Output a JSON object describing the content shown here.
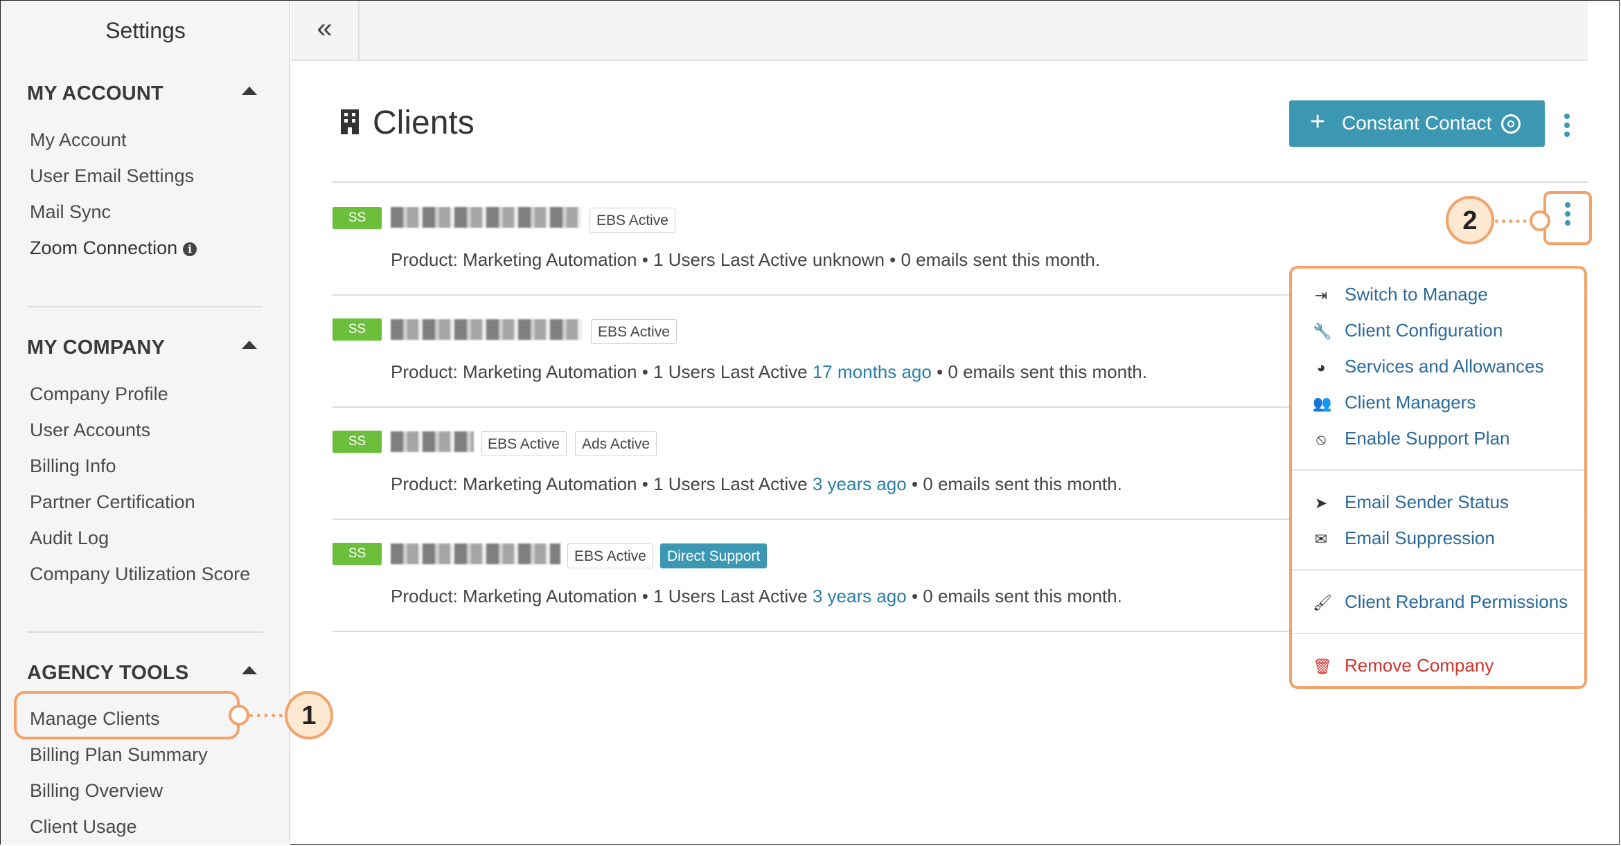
{
  "sidebar": {
    "title": "Settings",
    "sections": [
      {
        "label": "MY ACCOUNT",
        "items": [
          "My Account",
          "User Email Settings",
          "Mail Sync",
          "Zoom Connection"
        ]
      },
      {
        "label": "MY COMPANY",
        "items": [
          "Company Profile",
          "User Accounts",
          "Billing Info",
          "Partner Certification",
          "Audit Log",
          "Company Utilization Score"
        ]
      },
      {
        "label": "AGENCY TOOLS",
        "items": [
          "Manage Clients",
          "Billing Plan Summary",
          "Billing Overview",
          "Client Usage"
        ]
      }
    ]
  },
  "topbar": {
    "collapse_icon": "«"
  },
  "header": {
    "title": "Clients",
    "icon": "building-icon",
    "button_label": "Constant Contact",
    "button_plus": "+"
  },
  "clients": [
    {
      "badge": "SS",
      "tags": [
        "EBS Active"
      ],
      "meta_prefix": "Product: Marketing Automation • 1 Users Last Active ",
      "last_active": "unknown",
      "meta_suffix": " • 0 emails sent this month."
    },
    {
      "badge": "SS",
      "tags": [
        "EBS Active"
      ],
      "meta_prefix": "Product: Marketing Automation • 1 Users Last Active ",
      "last_active": "17 months ago",
      "meta_suffix": " • 0 emails sent this month."
    },
    {
      "badge": "SS",
      "tags": [
        "EBS Active",
        "Ads Active"
      ],
      "meta_prefix": "Product: Marketing Automation • 1 Users Last Active ",
      "last_active": "3 years ago",
      "meta_suffix": " • 0 emails sent this month."
    },
    {
      "badge": "SS",
      "tags": [
        "EBS Active",
        "Direct Support"
      ],
      "meta_prefix": "Product: Marketing Automation • 1 Users Last Active ",
      "last_active": "3 years ago",
      "meta_suffix": " • 0 emails sent this month."
    }
  ],
  "menu": {
    "items": [
      {
        "label": "Switch to Manage",
        "icon": "sign-in-icon"
      },
      {
        "label": "Client Configuration",
        "icon": "wrench-icon"
      },
      {
        "label": "Services and Allowances",
        "icon": "dashboard-icon"
      },
      {
        "label": "Client Managers",
        "icon": "users-icon"
      },
      {
        "label": "Enable Support Plan",
        "icon": "ban-icon"
      },
      {
        "label": "Email Sender Status",
        "icon": "send-icon"
      },
      {
        "label": "Email Suppression",
        "icon": "envelope-icon"
      },
      {
        "label": "Client Rebrand Permissions",
        "icon": "brush-icon"
      },
      {
        "label": "Remove Company",
        "icon": "trash-icon"
      }
    ]
  },
  "callouts": {
    "one": "1",
    "two": "2"
  },
  "colors": {
    "accent": "#3b97b2",
    "badge_green": "#6bbf3a",
    "callout_orange": "#f1a36b",
    "danger": "#d0342c",
    "link": "#2a7fa4"
  }
}
